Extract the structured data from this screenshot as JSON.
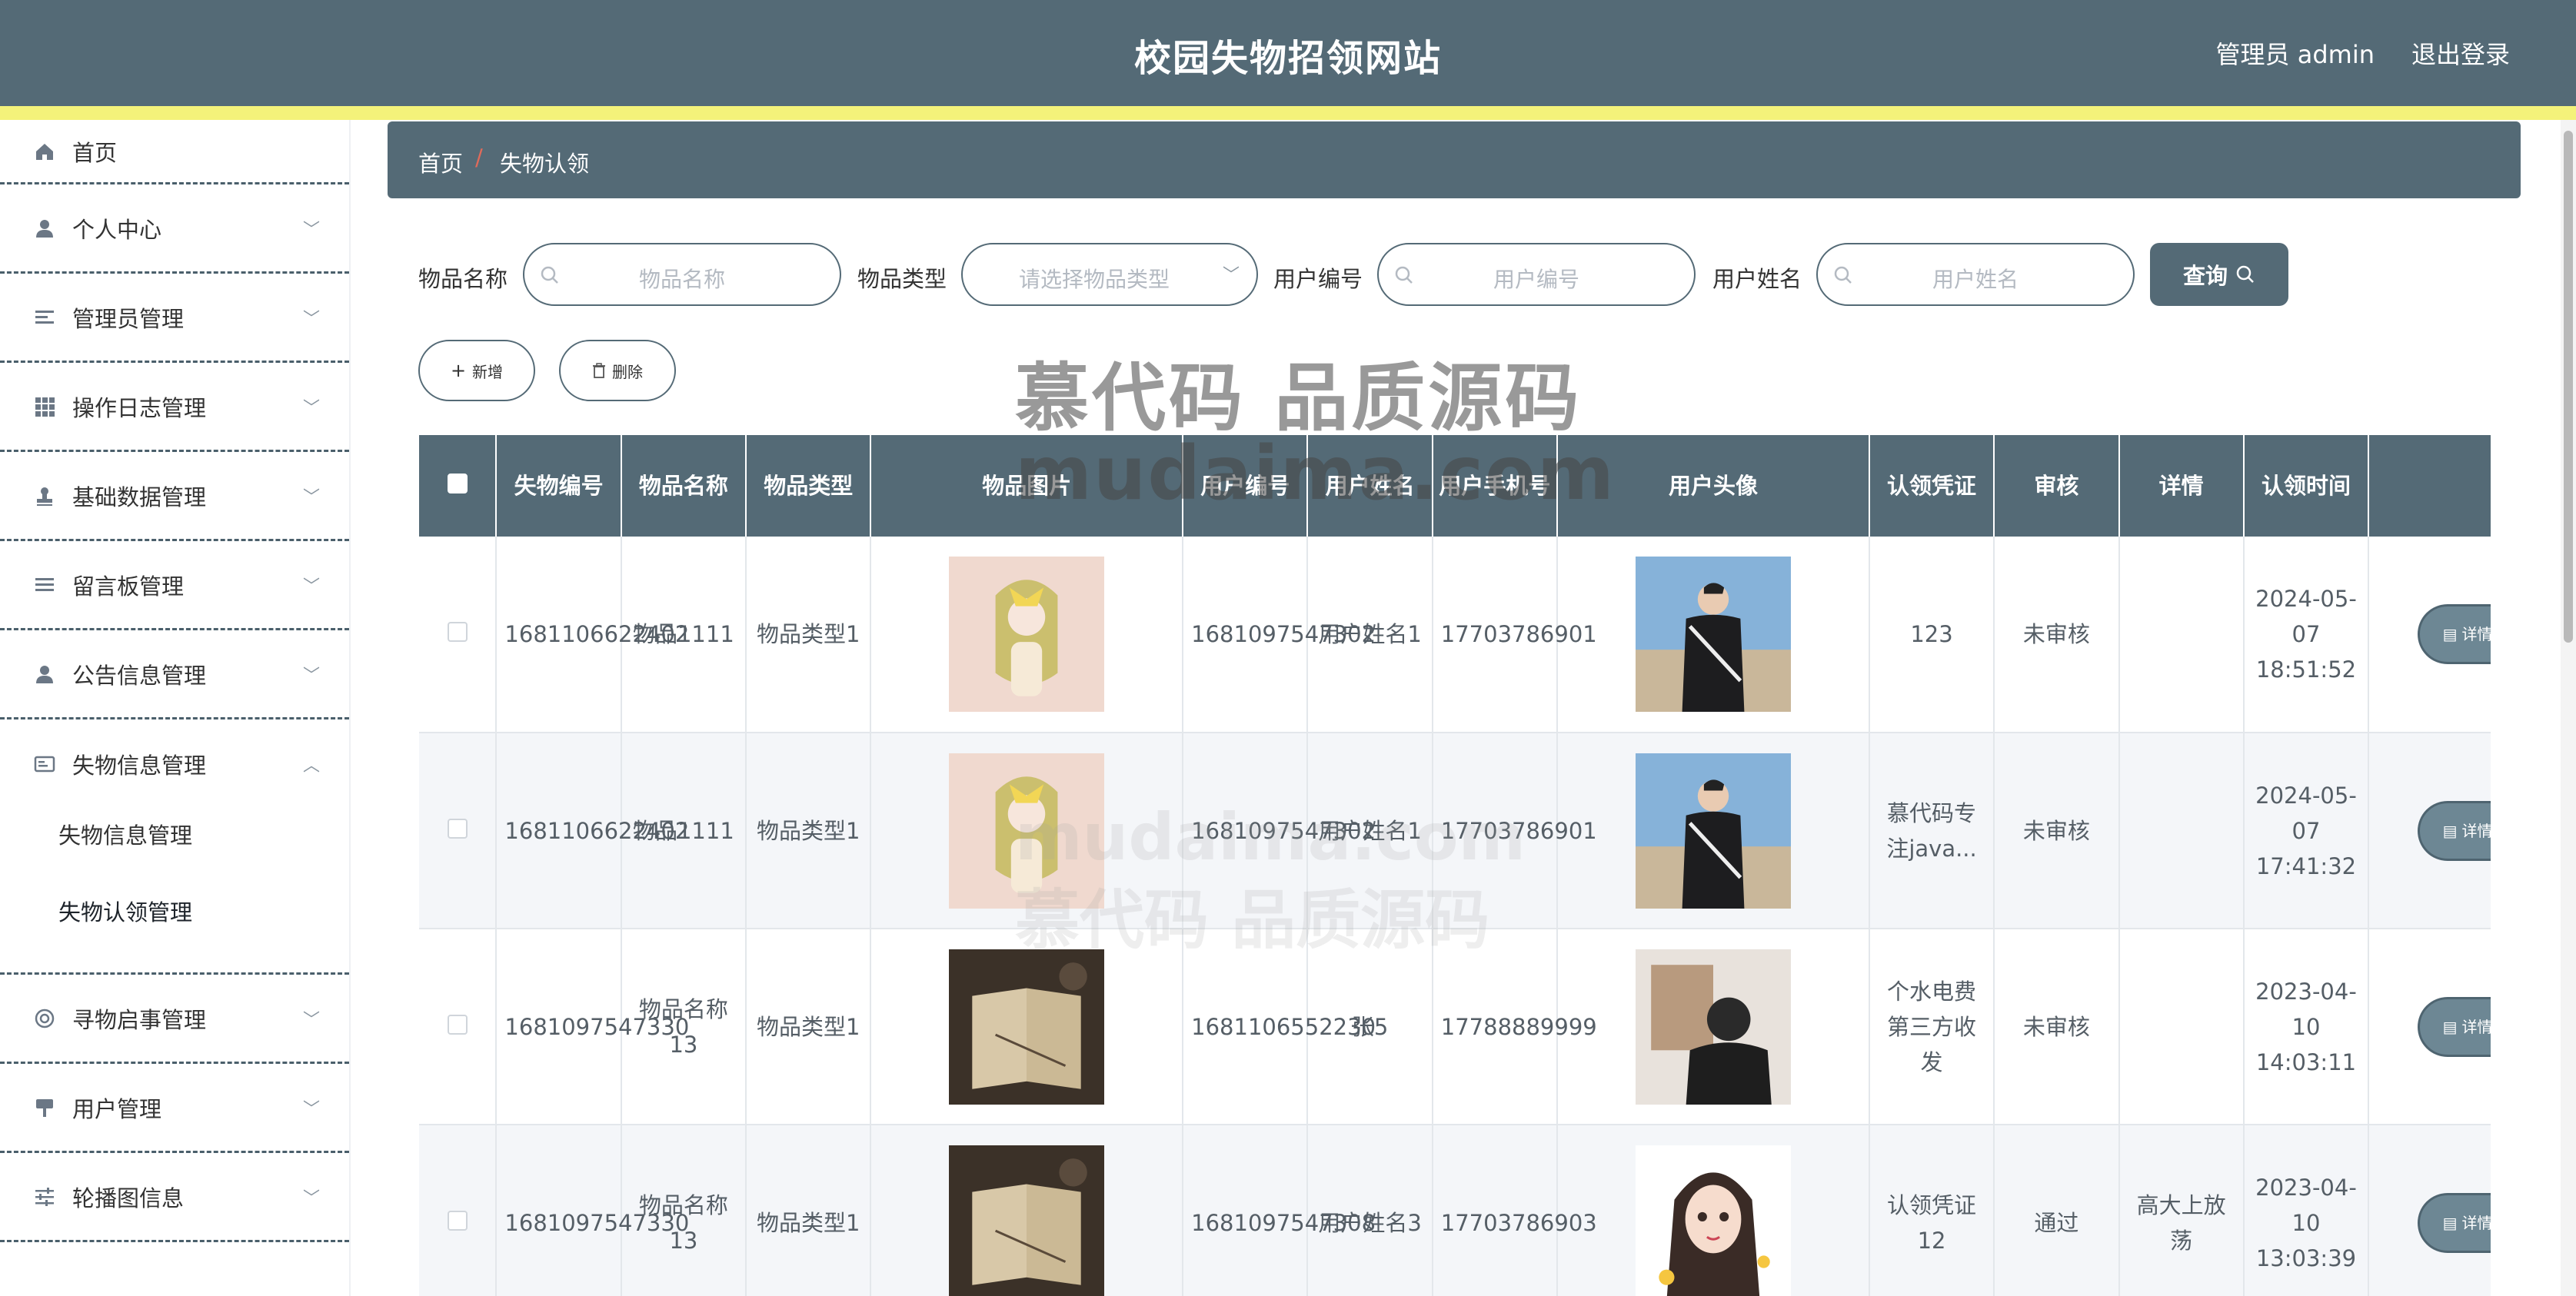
{
  "header": {
    "title": "校园失物招领网站",
    "admin": "管理员 admin",
    "logout": "退出登录"
  },
  "sidebar": {
    "items": [
      {
        "label": "首页",
        "icon": "home-icon"
      },
      {
        "label": "个人中心",
        "icon": "user-icon"
      },
      {
        "label": "管理员管理",
        "icon": "sliders-icon"
      },
      {
        "label": "操作日志管理",
        "icon": "grid-icon"
      },
      {
        "label": "基础数据管理",
        "icon": "stamp-icon"
      },
      {
        "label": "留言板管理",
        "icon": "list-icon"
      },
      {
        "label": "公告信息管理",
        "icon": "user-icon"
      },
      {
        "label": "失物信息管理",
        "icon": "card-icon"
      },
      {
        "label": "寻物启事管理",
        "icon": "lifebuoy-icon"
      },
      {
        "label": "用户管理",
        "icon": "sign-icon"
      },
      {
        "label": "轮播图信息",
        "icon": "tune-icon"
      }
    ],
    "sub_items": [
      "失物信息管理",
      "失物认领管理"
    ]
  },
  "breadcrumb": {
    "home": "首页",
    "sep": "/",
    "current": "失物认领"
  },
  "search": {
    "item_name_label": "物品名称",
    "item_name_placeholder": "物品名称",
    "item_type_label": "物品类型",
    "item_type_placeholder": "请选择物品类型",
    "user_no_label": "用户编号",
    "user_no_placeholder": "用户编号",
    "user_name_label": "用户姓名",
    "user_name_placeholder": "用户姓名",
    "query": "查询"
  },
  "actions": {
    "add": "新增",
    "delete": "删除"
  },
  "watermark": {
    "line1": "慕代码 品质源码",
    "line2": "mudaima.com"
  },
  "table": {
    "headers": [
      "失物编号",
      "物品名称",
      "物品类型",
      "物品图片",
      "用户编号",
      "用户姓名",
      "用户手机号",
      "用户头像",
      "认领凭证",
      "审核",
      "详情",
      "认领时间"
    ],
    "detail_label": "详情",
    "rows": [
      {
        "lost_no": "1681106622402",
        "name": "物品1111",
        "type": "物品类型1",
        "item_img": "anime-girl",
        "user_no": "1681097547302",
        "user_name": "用户姓名1",
        "phone": "17703786901",
        "avatar": "man-jacket",
        "proof": "123",
        "review": "未审核",
        "detail": "",
        "time": "2024-05-07 18:51:52"
      },
      {
        "lost_no": "1681106622402",
        "name": "物品1111",
        "type": "物品类型1",
        "item_img": "anime-girl",
        "user_no": "1681097547302",
        "user_name": "用户姓名1",
        "phone": "17703786901",
        "avatar": "man-jacket",
        "proof": "慕代码专注java...",
        "review": "未审核",
        "detail": "",
        "time": "2024-05-07 17:41:32"
      },
      {
        "lost_no": "1681097547330",
        "name": "物品名称13",
        "type": "物品类型1",
        "item_img": "old-book",
        "user_no": "1681106552230",
        "user_name": "张5",
        "phone": "17788889999",
        "avatar": "man-back",
        "proof": "个水电费第三方收发",
        "review": "未审核",
        "detail": "",
        "time": "2023-04-10 14:03:11"
      },
      {
        "lost_no": "1681097547330",
        "name": "物品名称13",
        "type": "物品类型1",
        "item_img": "old-book",
        "user_no": "1681097547308",
        "user_name": "用户姓名3",
        "phone": "17703786903",
        "avatar": "cartoon-girl",
        "proof": "认领凭证12",
        "review": "通过",
        "detail": "高大上放荡",
        "time": "2023-04-10 13:03:39"
      }
    ]
  },
  "colors": {
    "primary": "#546a76",
    "accent_stripe": "#f4f27a",
    "breadcrumb_sep": "#e06a5a"
  }
}
